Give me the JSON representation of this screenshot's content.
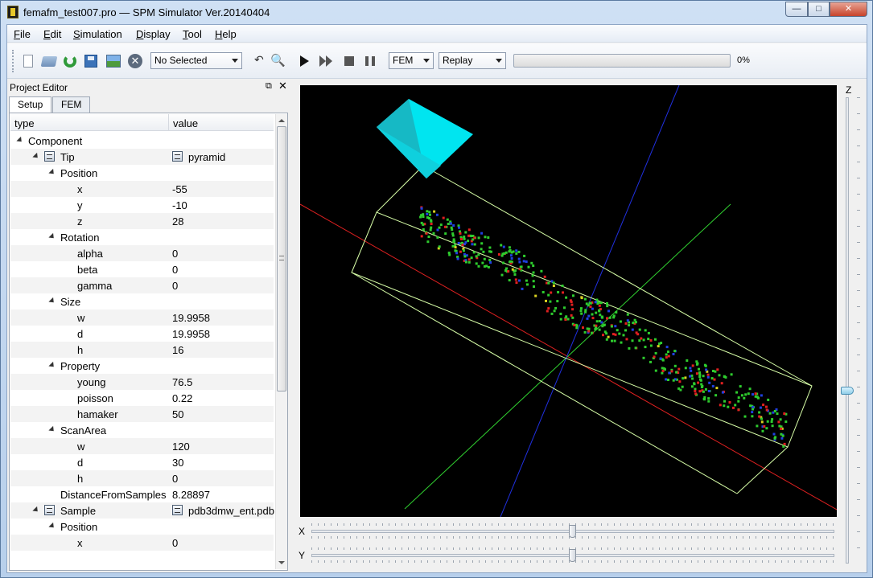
{
  "window": {
    "title": "femafm_test007.pro — SPM Simulator Ver.20140404",
    "minimize_glyph": "—",
    "maximize_glyph": "□",
    "close_glyph": "✕"
  },
  "menu": [
    {
      "label": "File",
      "mnemonic": "F",
      "rest": "ile"
    },
    {
      "label": "Edit",
      "mnemonic": "E",
      "rest": "dit"
    },
    {
      "label": "Simulation",
      "mnemonic": "S",
      "rest": "imulation"
    },
    {
      "label": "Display",
      "mnemonic": "D",
      "rest": "isplay"
    },
    {
      "label": "Tool",
      "mnemonic": "T",
      "rest": "ool"
    },
    {
      "label": "Help",
      "mnemonic": "H",
      "rest": "elp"
    }
  ],
  "toolbar": {
    "icons": [
      "new-file-icon",
      "open-folder-icon",
      "refresh-icon",
      "save-icon",
      "image-icon",
      "close-circle-icon",
      "undo-icon",
      "zoom-icon",
      "play-icon",
      "fast-forward-icon",
      "stop-icon",
      "pause-icon"
    ],
    "selection_combo": "No Selected",
    "mode_combo": "FEM",
    "replay_combo": "Replay",
    "progress_fraction": 0.0,
    "progress_text": "0%",
    "undo_glyph": "↶",
    "zoom_glyph": "🔍",
    "close_glyph": "✕"
  },
  "project_editor": {
    "title": "Project Editor",
    "float_glyph": "⧉",
    "close_glyph": "✕",
    "tabs": [
      "Setup",
      "FEM"
    ],
    "active_tab": "Setup",
    "columns": {
      "type": "type",
      "value": "value"
    },
    "rows": [
      {
        "label": "Component",
        "value": "",
        "level": 0,
        "expander": true
      },
      {
        "label": "Tip",
        "value": "pyramid",
        "level": 1,
        "expander": true,
        "icon": true,
        "value_icon": true
      },
      {
        "label": "Position",
        "value": "",
        "level": 2,
        "expander": true
      },
      {
        "label": "x",
        "value": "-55",
        "level": 3
      },
      {
        "label": "y",
        "value": "-10",
        "level": 3
      },
      {
        "label": "z",
        "value": "28",
        "level": 3
      },
      {
        "label": "Rotation",
        "value": "",
        "level": 2,
        "expander": true
      },
      {
        "label": "alpha",
        "value": "0",
        "level": 3
      },
      {
        "label": "beta",
        "value": "0",
        "level": 3
      },
      {
        "label": "gamma",
        "value": "0",
        "level": 3
      },
      {
        "label": "Size",
        "value": "",
        "level": 2,
        "expander": true
      },
      {
        "label": "w",
        "value": "19.9958",
        "level": 3
      },
      {
        "label": "d",
        "value": "19.9958",
        "level": 3
      },
      {
        "label": "h",
        "value": "16",
        "level": 3
      },
      {
        "label": "Property",
        "value": "",
        "level": 2,
        "expander": true
      },
      {
        "label": "young",
        "value": "76.5",
        "level": 3
      },
      {
        "label": "poisson",
        "value": "0.22",
        "level": 3
      },
      {
        "label": "hamaker",
        "value": "50",
        "level": 3
      },
      {
        "label": "ScanArea",
        "value": "",
        "level": 2,
        "expander": true
      },
      {
        "label": "w",
        "value": "120",
        "level": 3
      },
      {
        "label": "d",
        "value": "30",
        "level": 3
      },
      {
        "label": "h",
        "value": "0",
        "level": 3
      },
      {
        "label": "DistanceFromSamples",
        "value": "8.28897",
        "level": 2
      },
      {
        "label": "Sample",
        "value": "pdb3dmw_ent.pdb",
        "level": 1,
        "expander": true,
        "icon": true,
        "value_icon": true
      },
      {
        "label": "Position",
        "value": "",
        "level": 2,
        "expander": true
      },
      {
        "label": "x",
        "value": "0",
        "level": 3
      }
    ]
  },
  "viewport": {
    "background": "#000000",
    "tip_color": "#00e5f0",
    "box_color": "#d8ffa8",
    "axis_x_color": "#e02020",
    "axis_y_color": "#30d030",
    "axis_z_color": "#2030e0",
    "atom_colors": [
      "#2ecc2e",
      "#e02020",
      "#2040e0",
      "#d8d020"
    ]
  },
  "sliders": {
    "x_label": "X",
    "y_label": "Y",
    "z_label": "Z",
    "x_position": 0.5,
    "y_position": 0.5,
    "z_position": 0.62
  }
}
